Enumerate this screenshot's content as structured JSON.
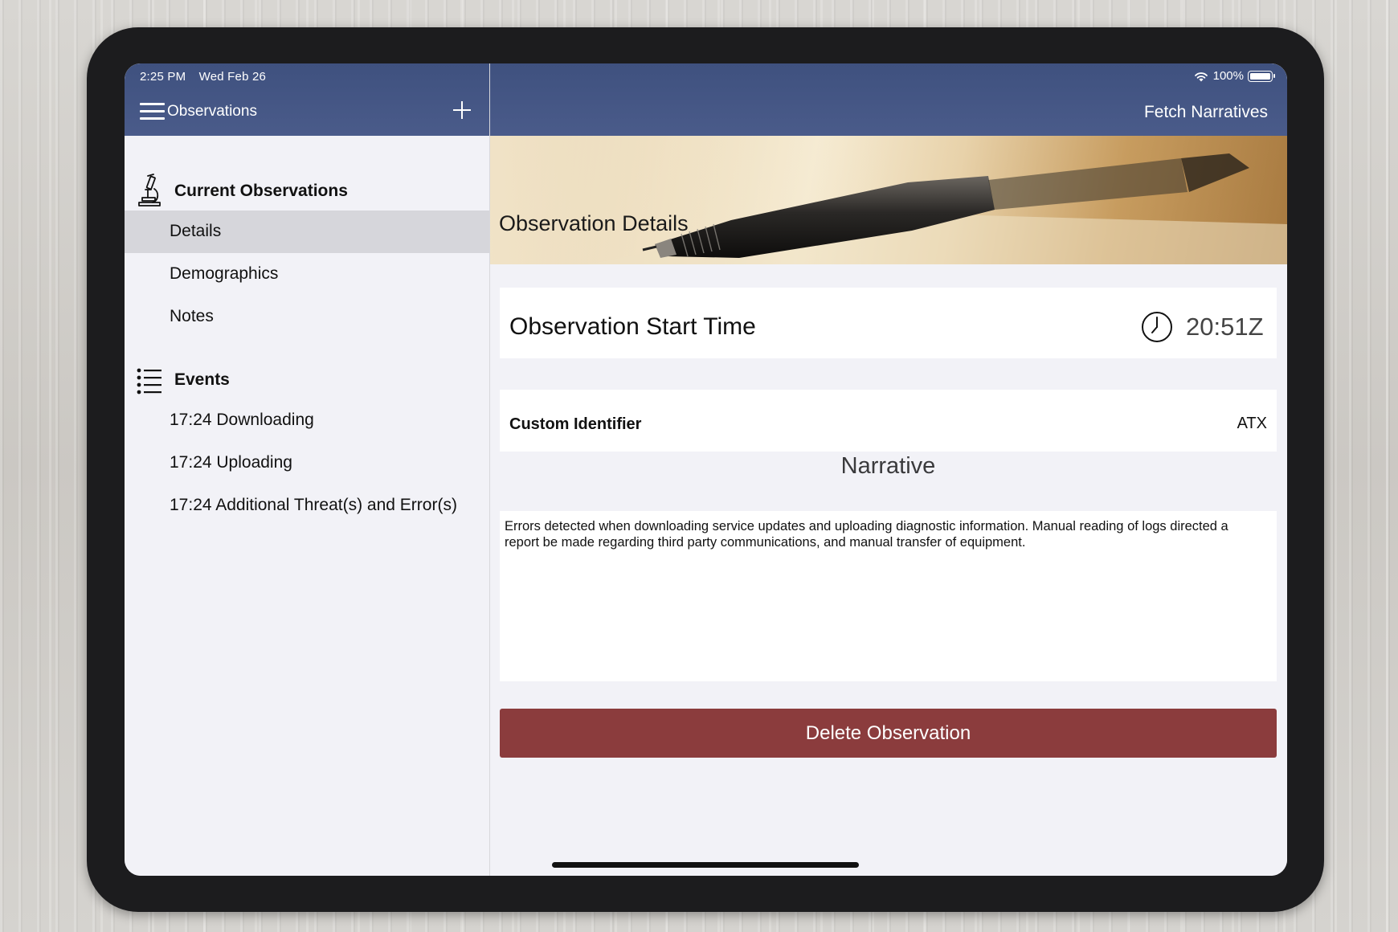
{
  "status_bar": {
    "time": "2:25 PM",
    "date": "Wed Feb 26",
    "battery": "100%"
  },
  "sidebar": {
    "title": "Observations",
    "sections": [
      {
        "label": "Current Observations",
        "icon": "microscope-icon",
        "items": [
          "Details",
          "Demographics",
          "Notes"
        ],
        "selected": "Details"
      },
      {
        "label": "Events",
        "icon": "list-icon",
        "items": [
          "17:24 Downloading",
          "17:24 Uploading",
          "17:24 Additional Threat(s) and Error(s)"
        ]
      }
    ]
  },
  "main": {
    "header_action": "Fetch Narratives",
    "banner_title": "Observation Details",
    "start_time": {
      "label": "Observation Start Time",
      "value": "20:51Z",
      "icon": "clock-icon"
    },
    "custom_identifier": {
      "label": "Custom Identifier",
      "value": "ATX"
    },
    "narrative": {
      "heading": "Narrative",
      "text": "Errors detected when downloading service updates and uploading diagnostic information.  Manual reading of logs directed a report be made regarding third party communications, and manual transfer of equipment."
    },
    "delete_label": "Delete Observation"
  },
  "colors": {
    "header": "#465886",
    "delete": "#8b3c3d",
    "selected_row": "#d6d6db",
    "background": "#f2f2f7"
  }
}
